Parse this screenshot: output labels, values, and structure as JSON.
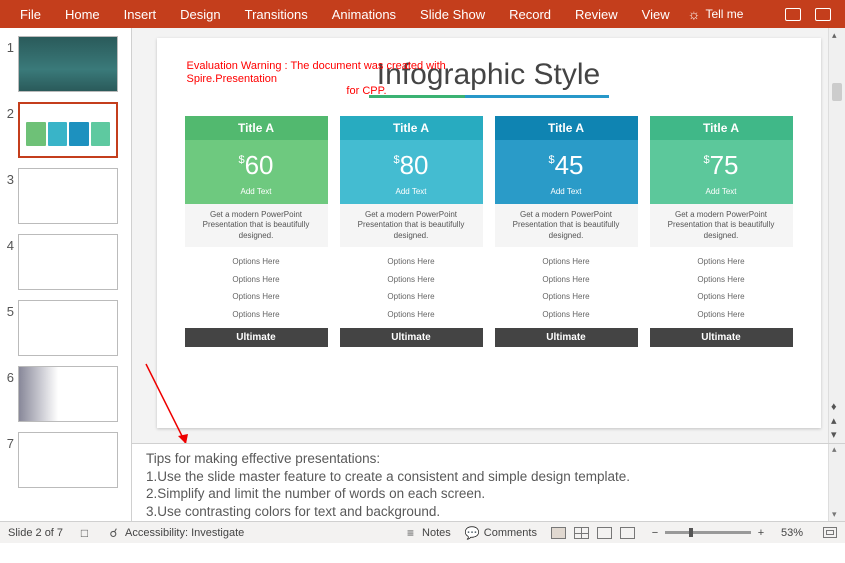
{
  "ribbon": {
    "tabs": [
      "File",
      "Home",
      "Insert",
      "Design",
      "Transitions",
      "Animations",
      "Slide Show",
      "Record",
      "Review",
      "View"
    ],
    "tellme": "Tell me"
  },
  "thumbnails": [
    {
      "n": 1
    },
    {
      "n": 2
    },
    {
      "n": 3
    },
    {
      "n": 4
    },
    {
      "n": 5
    },
    {
      "n": 6
    },
    {
      "n": 7
    }
  ],
  "selected_slide": 2,
  "slide": {
    "eval_warning_l1": "Evaluation Warning : The document was created with  Spire.Presentation",
    "eval_warning_l2": "for CPP.",
    "title": "Infographic Style",
    "cards": [
      {
        "title": "Title A",
        "price": "60",
        "add": "Add Text",
        "desc": "Get a modern PowerPoint Presentation that is beautifully designed.",
        "opts": [
          "Options Here",
          "Options Here",
          "Options Here",
          "Options Here"
        ],
        "ult": "Ultimate"
      },
      {
        "title": "Title A",
        "price": "80",
        "add": "Add Text",
        "desc": "Get a modern PowerPoint Presentation that is beautifully designed.",
        "opts": [
          "Options Here",
          "Options Here",
          "Options Here",
          "Options Here"
        ],
        "ult": "Ultimate"
      },
      {
        "title": "Title A",
        "price": "45",
        "add": "Add Text",
        "desc": "Get a modern PowerPoint Presentation that is beautifully designed.",
        "opts": [
          "Options Here",
          "Options Here",
          "Options Here",
          "Options Here"
        ],
        "ult": "Ultimate"
      },
      {
        "title": "Title A",
        "price": "75",
        "add": "Add Text",
        "desc": "Get a modern PowerPoint Presentation that is beautifully designed.",
        "opts": [
          "Options Here",
          "Options Here",
          "Options Here",
          "Options Here"
        ],
        "ult": "Ultimate"
      }
    ]
  },
  "notes": {
    "line1": "Tips for making effective presentations:",
    "line2": "1.Use the slide master feature to create a consistent and simple design template.",
    "line3": "2.Simplify and limit the number of words on each screen.",
    "line4": "3.Use contrasting colors for text and background."
  },
  "status": {
    "slide_pos": "Slide 2 of 7",
    "access": "Accessibility: Investigate",
    "notes_btn": "Notes",
    "comments_btn": "Comments",
    "zoom_pct": "53%"
  }
}
